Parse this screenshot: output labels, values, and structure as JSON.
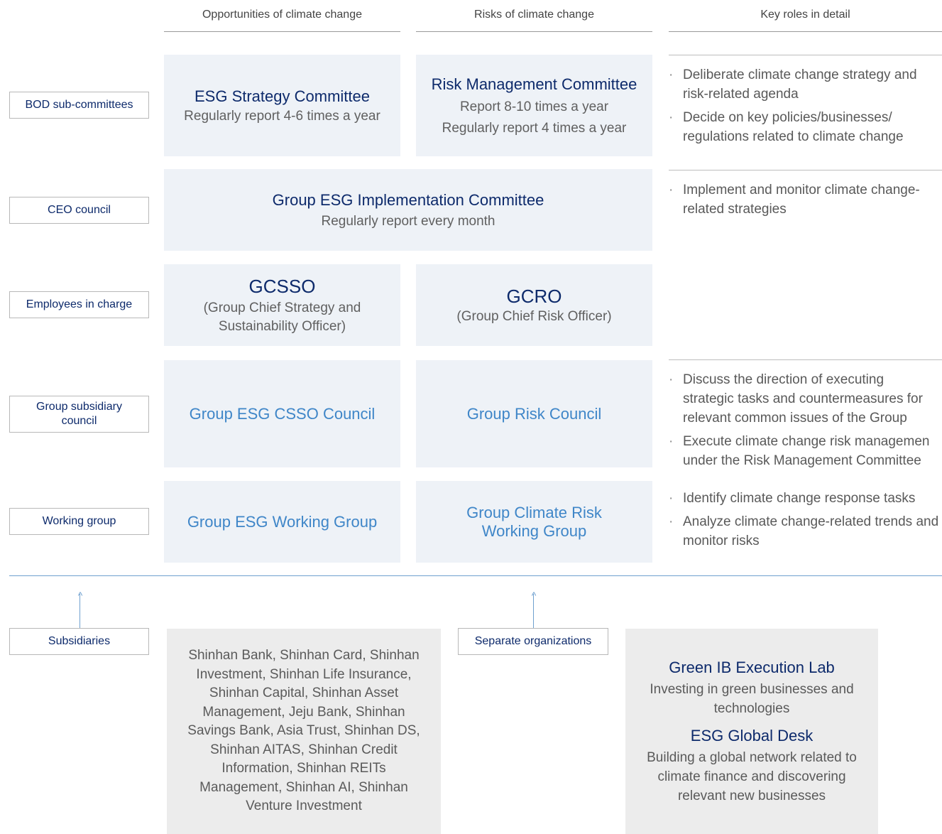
{
  "columns": {
    "opportunities": "Opportunities of climate change",
    "risks": "Risks of climate change",
    "roles": "Key roles in detail"
  },
  "row_labels": {
    "bod": "BOD sub-committees",
    "ceo": "CEO council",
    "employees": "Employees in charge",
    "subsidiary_council": "Group subsidiary council",
    "working_group": "Working group"
  },
  "boxes": {
    "esg_strategy": {
      "title": "ESG Strategy Committee",
      "line1": "Regularly report 4-6 times a year"
    },
    "risk_mgmt": {
      "title": "Risk Management Committee",
      "line1": "Report 8-10 times a year",
      "line2": "Regularly report 4 times a year"
    },
    "group_esg_impl": {
      "title": "Group ESG Implementation Committee",
      "line1": "Regularly report every month"
    },
    "gcsso": {
      "title": "GCSSO",
      "line1": "(Group Chief Strategy and Sustainability Officer)"
    },
    "gcro": {
      "title": "GCRO",
      "line1": "(Group Chief Risk Officer)"
    },
    "esg_csso_council": {
      "title": "Group ESG CSSO Council"
    },
    "risk_council": {
      "title": "Group Risk Council"
    },
    "esg_working_group": {
      "title": "Group ESG Working Group"
    },
    "climate_risk_wg": {
      "title": "Group Climate Risk Working Group"
    }
  },
  "roles": {
    "bod": [
      "Deliberate climate change strategy and risk-related agenda",
      "Decide on key policies/businesses/ regulations related to climate change"
    ],
    "ceo": [
      "Implement and monitor climate change-related strategies"
    ],
    "council": [
      "Discuss the direction of executing strategic tasks and countermeasures for relevant common issues of the Group",
      "Execute climate change risk managemen under the Risk Management Committee"
    ],
    "working": [
      "Identify climate change response tasks",
      "Analyze climate change-related trends and monitor risks"
    ]
  },
  "bottom": {
    "subsidiaries_label": "Subsidiaries",
    "subsidiaries_list": "Shinhan Bank, Shinhan Card, Shinhan Investment, Shinhan Life Insurance, Shinhan Capital, Shinhan Asset Management, Jeju Bank, Shinhan Savings Bank, Asia Trust, Shinhan DS, Shinhan AITAS, Shinhan Credit Information, Shinhan REITs Management, Shinhan AI, Shinhan Venture Investment",
    "separate_label": "Separate organizations",
    "green_ib_title": "Green IB Execution Lab",
    "green_ib_desc": "Investing in green businesses and technologies",
    "esg_desk_title": "ESG Global Desk",
    "esg_desk_desc": "Building a global network related to climate finance and discovering relevant new businesses"
  }
}
